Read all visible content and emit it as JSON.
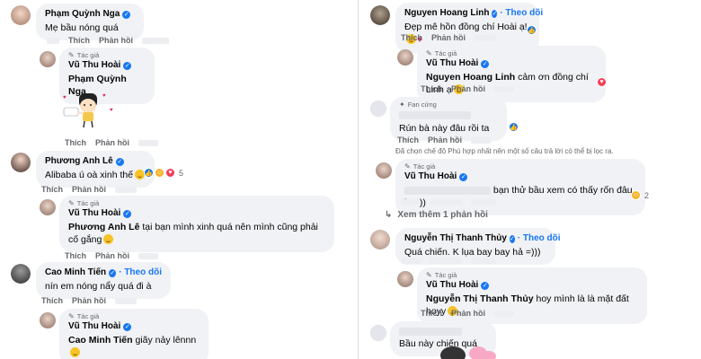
{
  "labels": {
    "like": "Thích",
    "reply": "Phản hồi",
    "author_badge": "Tác giả",
    "fan_badge": "Fan cứng"
  },
  "left": {
    "c1": {
      "name": "Phạm Quỳnh Nga",
      "text": "Mẹ bầu nóng quá"
    },
    "r1": {
      "name": "Vũ Thu Hoài",
      "mention": "Phạm Quỳnh Nga"
    },
    "c2": {
      "name": "Phương Anh Lê",
      "text": "Alibaba ú oà xinh thế",
      "react_count": "5"
    },
    "r2": {
      "name": "Vũ Thu Hoài",
      "mention": "Phương Anh Lê",
      "text": " tại bạn mình xinh quá nên mình cũng phải cố gắng"
    },
    "c3": {
      "name": "Cao Minh Tiến",
      "follow": "· Theo dõi",
      "text": "nín em nóng nẩy quá đi à"
    },
    "r3": {
      "name": "Vũ Thu Hoài",
      "mention": "Cao Minh Tiến",
      "text": " giãy nảy lênnn"
    }
  },
  "right": {
    "c1": {
      "name": "Nguyen Hoang Linh",
      "follow": "· Theo dõi",
      "text": "Đẹp mê hồn đồng chí Hoài ạ!"
    },
    "r1": {
      "name": "Vũ Thu Hoài",
      "mention": "Nguyen Hoang Linh",
      "text": " cảm ơn đồng chí Linh ạ"
    },
    "c2": {
      "text": "Rún bà này đâu rồi ta"
    },
    "note": "Đã chọn chế độ Phù hợp nhất nên một số câu trả lời có thể bị lọc ra.",
    "r2": {
      "name": "Vũ Thu Hoài",
      "text": "bạn thử bầu xem có thấy rốn đâu ko :))",
      "react_count": "2"
    },
    "view_more": "Xem thêm 1 phản hồi",
    "c3": {
      "name": "Nguyễn Thị Thanh Thủy",
      "follow": "· Theo dõi",
      "text": "Quá chiến. K lụa bay bay hả =)))"
    },
    "r3": {
      "name": "Vũ Thu Hoài",
      "mention": "Nguyễn Thị Thanh Thủy",
      "text": " hoy mình là là mặt đất hoyy"
    },
    "c4": {
      "text": "Bầu này chiến quá"
    }
  },
  "colors": {
    "accent": "#1877f2",
    "bubble": "#f0f2f5",
    "meta": "#65676b"
  }
}
